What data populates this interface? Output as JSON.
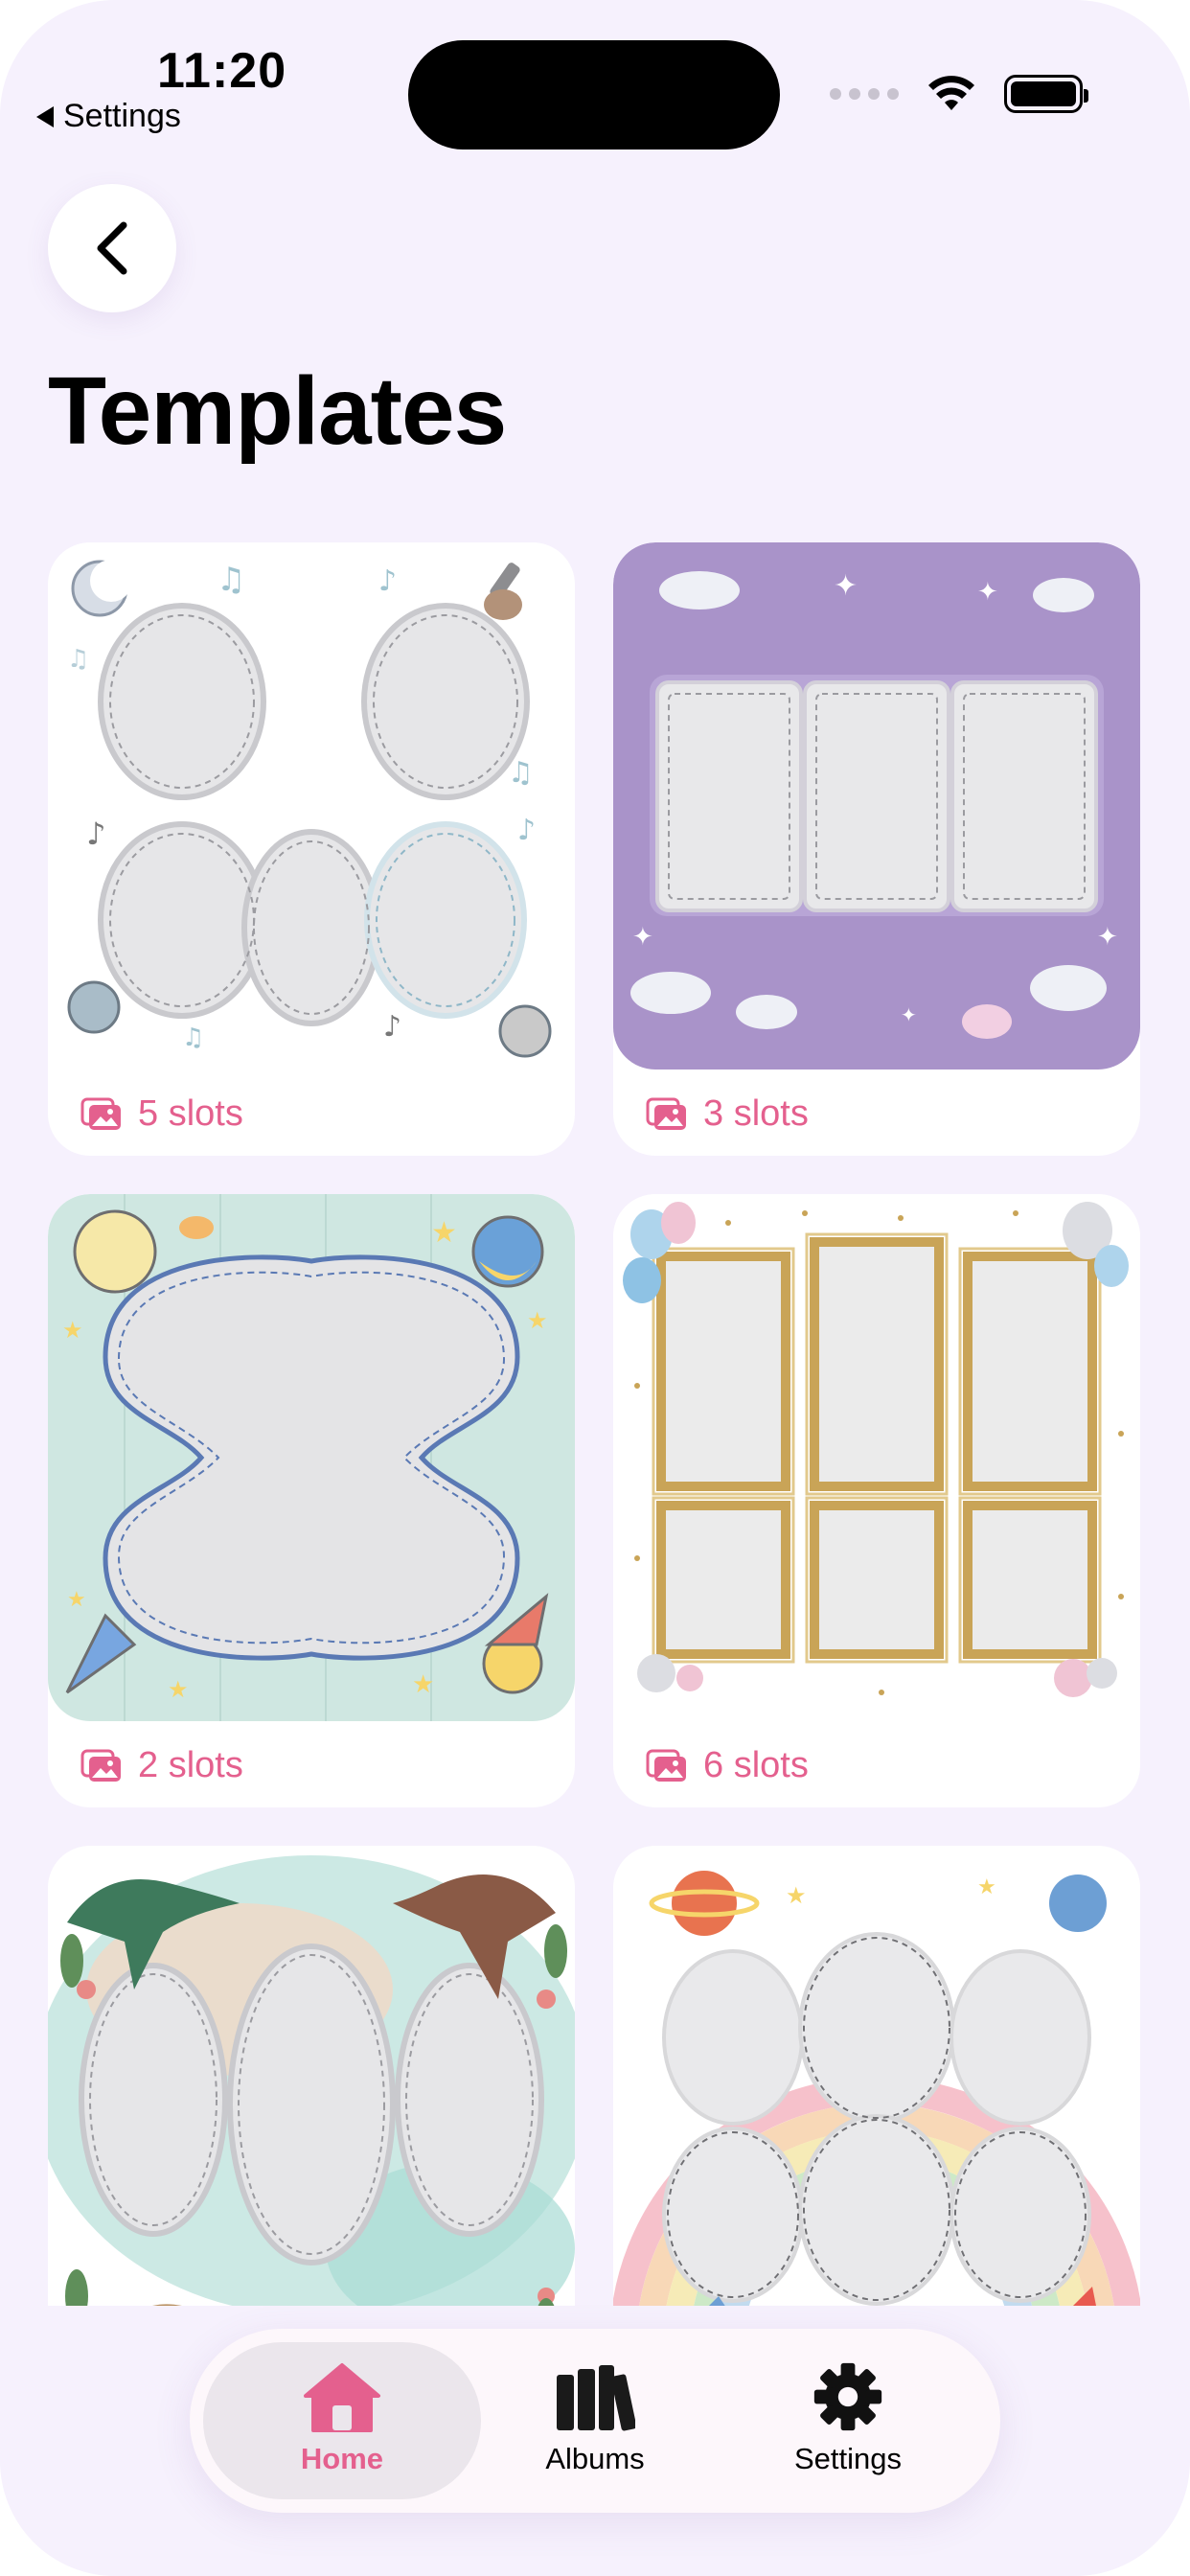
{
  "status_bar": {
    "time": "11:20",
    "back_app": "Settings"
  },
  "header": {
    "title": "Templates"
  },
  "templates": [
    {
      "slots_label": "5 slots",
      "theme": "music"
    },
    {
      "slots_label": "3 slots",
      "theme": "unicorns"
    },
    {
      "slots_label": "2 slots",
      "theme": "space"
    },
    {
      "slots_label": "6 slots",
      "theme": "balloons-gold-frames"
    },
    {
      "slots_label": "",
      "theme": "dinosaurs"
    },
    {
      "slots_label": "",
      "theme": "rainbow-space"
    }
  ],
  "tabbar": {
    "items": [
      {
        "label": "Home",
        "icon": "home-icon",
        "active": true
      },
      {
        "label": "Albums",
        "icon": "albums-icon",
        "active": false
      },
      {
        "label": "Settings",
        "icon": "gear-icon",
        "active": false
      }
    ]
  },
  "colors": {
    "accent": "#e4608e",
    "background": "#f6f1fd"
  }
}
